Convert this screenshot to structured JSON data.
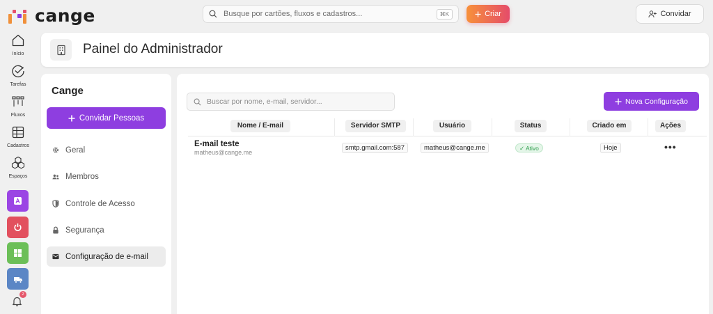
{
  "app": {
    "logo_text": "cange",
    "brand_color": "#8e3ee0",
    "accent_gradient": [
      "#f7913a",
      "#e54c6a"
    ]
  },
  "topbar": {
    "search_placeholder": "Busque por cartões, fluxos e cadastros...",
    "search_shortcut": "⌘K",
    "create_label": "Criar",
    "invite_label": "Convidar"
  },
  "rail": {
    "items": [
      {
        "label": "Início",
        "icon": "home-icon"
      },
      {
        "label": "Tarefas",
        "icon": "check-circle-icon"
      },
      {
        "label": "Fluxos",
        "icon": "flows-icon"
      },
      {
        "label": "Cadastros",
        "icon": "table-icon"
      },
      {
        "label": "Espaços",
        "icon": "cubes-icon"
      }
    ],
    "apps": [
      {
        "icon": "app-store-icon",
        "color": "#9b45e4"
      },
      {
        "icon": "power-icon",
        "color": "#e2505e"
      },
      {
        "icon": "grid-icon",
        "color": "#6cbf58"
      },
      {
        "icon": "truck-icon",
        "color": "#5b86c5"
      }
    ],
    "notification_count": "2"
  },
  "header": {
    "title": "Painel do Administrador",
    "icon": "building-icon"
  },
  "sidebar": {
    "title": "Cange",
    "invite_button": "Convidar Pessoas",
    "items": [
      {
        "label": "Geral",
        "icon": "gear-icon"
      },
      {
        "label": "Membros",
        "icon": "users-icon"
      },
      {
        "label": "Controle de Acesso",
        "icon": "shield-icon"
      },
      {
        "label": "Segurança",
        "icon": "lock-icon"
      },
      {
        "label": "Configuração de e-mail",
        "icon": "mail-icon",
        "active": true
      }
    ]
  },
  "main": {
    "search_placeholder": "Buscar por nome, e-mail, servidor...",
    "new_button": "Nova Configuração",
    "columns": [
      "Nome / E-mail",
      "Servidor SMTP",
      "Usuário",
      "Status",
      "Criado em",
      "Ações"
    ],
    "rows": [
      {
        "name": "E-mail teste",
        "email": "matheus@cange.me",
        "smtp": "smtp.gmail.com:587",
        "user": "matheus@cange.me",
        "status": "✓ Ativo",
        "created": "Hoje",
        "actions": "•••"
      }
    ]
  }
}
